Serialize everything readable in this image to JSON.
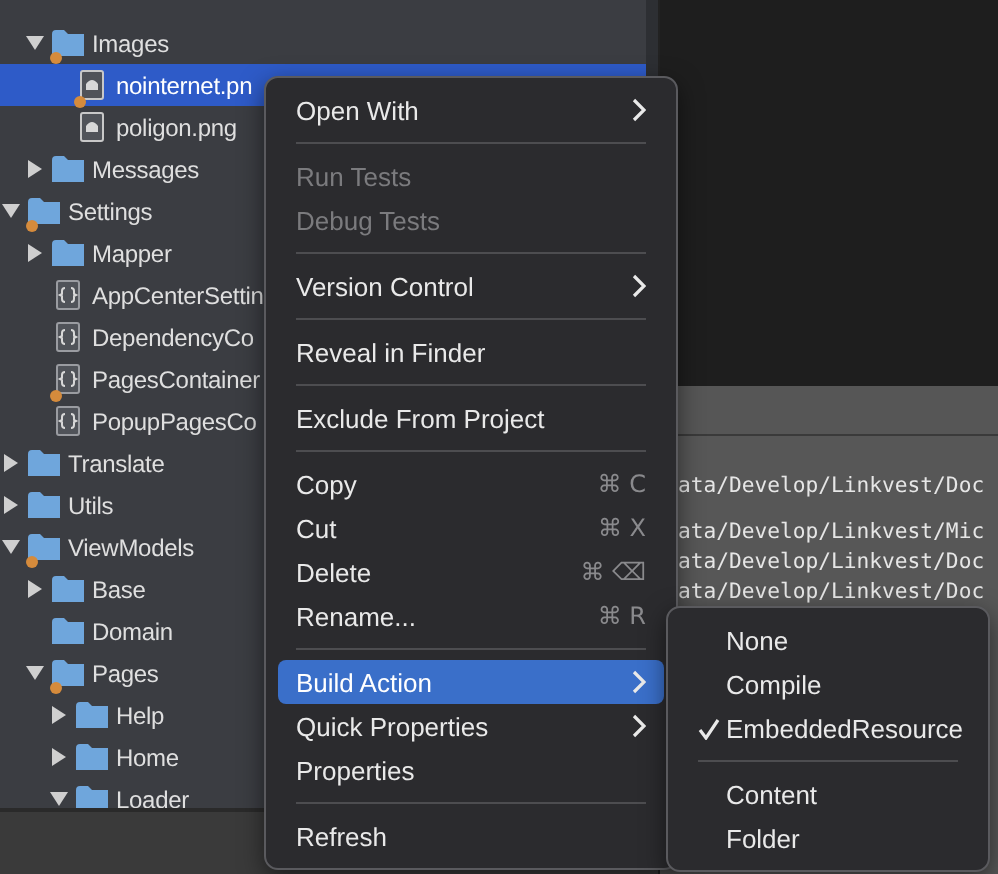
{
  "tree": [
    {
      "label": "Images",
      "kind": "folder",
      "expanded": true,
      "modified": true,
      "selected": false,
      "children": [
        {
          "label": "nointernet.pn",
          "kind": "image",
          "modified": true,
          "selected": true
        },
        {
          "label": "poligon.png",
          "kind": "image",
          "modified": false,
          "selected": false
        }
      ]
    },
    {
      "label": "Messages",
      "kind": "folder",
      "expanded": false,
      "modified": false,
      "selected": false
    }
  ],
  "tree_root": [
    {
      "label": "Settings",
      "kind": "folder",
      "expanded": true,
      "modified": true,
      "selected": false,
      "children": [
        {
          "label": "Mapper",
          "kind": "folder",
          "expanded": false,
          "modified": false,
          "selected": false
        },
        {
          "label": "AppCenterSettin",
          "kind": "code",
          "modified": false,
          "selected": false
        },
        {
          "label": "DependencyCo",
          "kind": "code",
          "modified": false,
          "selected": false
        },
        {
          "label": "PagesContainer",
          "kind": "code",
          "modified": true,
          "selected": false
        },
        {
          "label": "PopupPagesCo",
          "kind": "code",
          "modified": false,
          "selected": false
        }
      ]
    },
    {
      "label": "Translate",
      "kind": "folder",
      "expanded": false,
      "modified": false,
      "selected": false
    },
    {
      "label": "Utils",
      "kind": "folder",
      "expanded": false,
      "modified": false,
      "selected": false
    },
    {
      "label": "ViewModels",
      "kind": "folder",
      "expanded": true,
      "modified": true,
      "selected": false,
      "children": [
        {
          "label": "Base",
          "kind": "folder",
          "expanded": false,
          "modified": false,
          "selected": false
        },
        {
          "label": "Domain",
          "kind": "folder",
          "modified": false,
          "selected": false
        },
        {
          "label": "Pages",
          "kind": "folder",
          "expanded": true,
          "modified": true,
          "selected": false,
          "children": [
            {
              "label": "Help",
              "kind": "folder",
              "expanded": false,
              "modified": false,
              "selected": false
            },
            {
              "label": "Home",
              "kind": "folder",
              "expanded": false,
              "modified": false,
              "selected": false
            },
            {
              "label": "Loader",
              "kind": "folder",
              "expanded": true,
              "modified": false,
              "selected": false
            }
          ]
        }
      ]
    }
  ],
  "log_lines": [
    "ata/Develop/Linkvest/Doc",
    "ata/Develop/Linkvest/Mic",
    "ata/Develop/Linkvest/Doc",
    "ata/Develop/Linkvest/Doc"
  ],
  "context_menu": [
    {
      "kind": "item",
      "label": "Open With",
      "submenu": true,
      "disabled": false,
      "selected": false
    },
    {
      "kind": "separator"
    },
    {
      "kind": "item",
      "label": "Run Tests",
      "disabled": true,
      "selected": false
    },
    {
      "kind": "item",
      "label": "Debug Tests",
      "disabled": true,
      "selected": false
    },
    {
      "kind": "separator"
    },
    {
      "kind": "item",
      "label": "Version Control",
      "submenu": true,
      "disabled": false,
      "selected": false
    },
    {
      "kind": "separator"
    },
    {
      "kind": "item",
      "label": "Reveal in Finder",
      "disabled": false,
      "selected": false
    },
    {
      "kind": "separator"
    },
    {
      "kind": "item",
      "label": "Exclude From Project",
      "disabled": false,
      "selected": false
    },
    {
      "kind": "separator"
    },
    {
      "kind": "item",
      "label": "Copy",
      "shortcut": "⌘ C",
      "disabled": false,
      "selected": false
    },
    {
      "kind": "item",
      "label": "Cut",
      "shortcut": "⌘ X",
      "disabled": false,
      "selected": false
    },
    {
      "kind": "item",
      "label": "Delete",
      "shortcut": "⌘ ⌫",
      "disabled": false,
      "selected": false
    },
    {
      "kind": "item",
      "label": "Rename...",
      "shortcut": "⌘ R",
      "disabled": false,
      "selected": false
    },
    {
      "kind": "separator"
    },
    {
      "kind": "item",
      "label": "Build Action",
      "submenu": true,
      "disabled": false,
      "selected": true
    },
    {
      "kind": "item",
      "label": "Quick Properties",
      "submenu": true,
      "disabled": false,
      "selected": false
    },
    {
      "kind": "item",
      "label": "Properties",
      "disabled": false,
      "selected": false
    },
    {
      "kind": "separator"
    },
    {
      "kind": "item",
      "label": "Refresh",
      "disabled": false,
      "selected": false
    }
  ],
  "submenu": [
    {
      "kind": "item",
      "label": "None",
      "checked": false
    },
    {
      "kind": "item",
      "label": "Compile",
      "checked": false
    },
    {
      "kind": "item",
      "label": "EmbeddedResource",
      "checked": true
    },
    {
      "kind": "separator"
    },
    {
      "kind": "item",
      "label": "Content",
      "checked": false
    },
    {
      "kind": "item",
      "label": "Folder",
      "checked": false
    }
  ]
}
